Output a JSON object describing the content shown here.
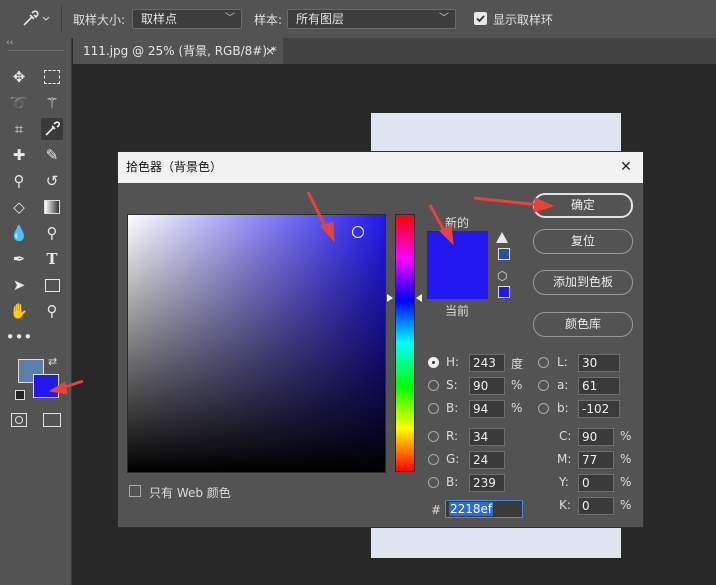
{
  "options_bar": {
    "sample_size_label": "取样大小:",
    "sample_size_value": "取样点",
    "sample_label": "样本:",
    "sample_value": "所有图层",
    "show_ring_label": "显示取样环"
  },
  "document_tab": {
    "title": "111.jpg @ 25% (背景, RGB/8#) *",
    "close": "×"
  },
  "color_picker": {
    "title": "拾色器（背景色）",
    "close": "✕",
    "new_label": "新的",
    "current_label": "当前",
    "new_color": "#2218ef",
    "current_color": "#2218ef",
    "buttons": {
      "ok": "确定",
      "reset": "复位",
      "add_to_swatches": "添加到色板",
      "color_libraries": "颜色库"
    },
    "web_only_label": "只有 Web 颜色",
    "hsb": {
      "h_label": "H:",
      "h_value": "243",
      "h_unit": "度",
      "s_label": "S:",
      "s_value": "90",
      "s_unit": "%",
      "b_label": "B:",
      "b_value": "94",
      "b_unit": "%"
    },
    "lab": {
      "l_label": "L:",
      "l_value": "30",
      "a_label": "a:",
      "a_value": "61",
      "b_label": "b:",
      "b_value": "-102"
    },
    "rgb": {
      "r_label": "R:",
      "r_value": "34",
      "g_label": "G:",
      "g_value": "24",
      "b_label": "B:",
      "b_value": "239"
    },
    "cmyk": {
      "c_label": "C:",
      "c_value": "90",
      "c_unit": "%",
      "m_label": "M:",
      "m_value": "77",
      "m_unit": "%",
      "y_label": "Y:",
      "y_value": "0",
      "y_unit": "%",
      "k_label": "K:",
      "k_value": "0",
      "k_unit": "%"
    },
    "hex_label": "#",
    "hex_value": "2218ef"
  },
  "swatches": {
    "foreground": "#5b7fa8",
    "background": "#2218ef"
  },
  "colors": {
    "annotation_arrow": "#e8423a",
    "ui_bg": "#535353"
  }
}
